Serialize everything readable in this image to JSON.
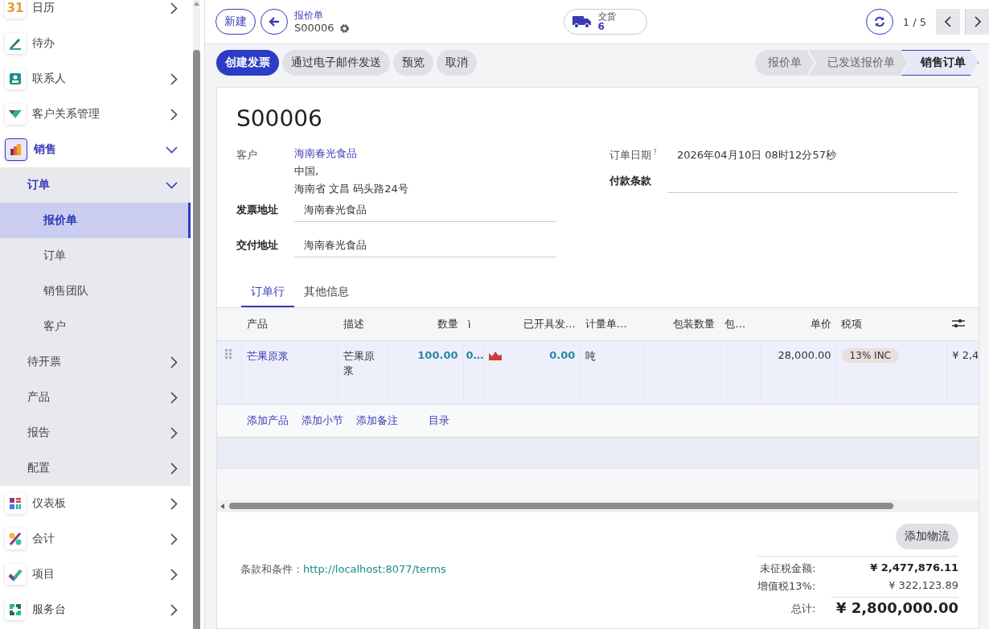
{
  "sidebar": {
    "apps": [
      {
        "label": "日历",
        "icon_text": "31",
        "has_submenu": true,
        "expanded": false,
        "selected": false
      },
      {
        "label": "待办",
        "has_submenu": false,
        "expanded": false,
        "selected": false
      },
      {
        "label": "联系人",
        "has_submenu": true,
        "expanded": false,
        "selected": false
      },
      {
        "label": "客户关系管理",
        "has_submenu": true,
        "expanded": false,
        "selected": false
      },
      {
        "label": "销售",
        "has_submenu": true,
        "expanded": true,
        "selected": true,
        "children": [
          {
            "label": "订单",
            "has_submenu": true,
            "expanded": true,
            "selected": false,
            "children": [
              {
                "label": "报价单",
                "selected": true
              },
              {
                "label": "订单",
                "selected": false
              },
              {
                "label": "销售团队",
                "selected": false
              },
              {
                "label": "客户",
                "selected": false
              }
            ]
          },
          {
            "label": "待开票",
            "has_submenu": true,
            "expanded": false,
            "selected": false
          },
          {
            "label": "产品",
            "has_submenu": true,
            "expanded": false,
            "selected": false
          },
          {
            "label": "报告",
            "has_submenu": true,
            "expanded": false,
            "selected": false
          },
          {
            "label": "配置",
            "has_submenu": true,
            "expanded": false,
            "selected": false
          }
        ]
      },
      {
        "label": "仪表板",
        "has_submenu": true,
        "expanded": false,
        "selected": false
      },
      {
        "label": "会计",
        "has_submenu": true,
        "expanded": false,
        "selected": false
      },
      {
        "label": "项目",
        "has_submenu": true,
        "expanded": false,
        "selected": false
      },
      {
        "label": "服务台",
        "has_submenu": true,
        "expanded": false,
        "selected": false
      }
    ]
  },
  "toolbar": {
    "new_button": "新建",
    "breadcrumb": "报价单",
    "record": "S00006",
    "smart_button": {
      "label": "交货",
      "count": "6"
    },
    "pager": "1 / 5"
  },
  "actions": [
    {
      "label": "创建发票",
      "primary": true
    },
    {
      "label": "通过电子邮件发送",
      "primary": false
    },
    {
      "label": "预览",
      "primary": false
    },
    {
      "label": "取消",
      "primary": false
    }
  ],
  "statusbar": [
    {
      "label": "报价单",
      "selected": false
    },
    {
      "label": "已发送报价单",
      "selected": false
    },
    {
      "label": "销售订单",
      "selected": true
    }
  ],
  "form": {
    "title": "S00006",
    "customer": {
      "label": "客户",
      "name": "海南春光食品",
      "address": [
        "中国,",
        "海南省 文昌 码头路24号"
      ]
    },
    "invoice_address": {
      "label": "发票地址",
      "value": "海南春光食品"
    },
    "delivery_address": {
      "label": "交付地址",
      "value": "海南春光食品"
    },
    "order_date": {
      "label": "订单日期",
      "help": "?",
      "value": "2026年04月10日 08时12分57秒"
    },
    "payment_terms": {
      "label": "付款条款"
    }
  },
  "tabs": [
    {
      "label": "订单行",
      "selected": true
    },
    {
      "label": "其他信息",
      "selected": false
    }
  ],
  "order_lines": {
    "columns": [
      "产品",
      "描述",
      "数量",
      "ì",
      "已开具发…",
      "计量单…",
      "包装数量",
      "包…",
      "单价",
      "税项"
    ],
    "rows": [
      {
        "product": "芒果原浆",
        "description": "芒果原浆",
        "quantity": "100.00",
        "column_4": "0…",
        "forecast_warning": true,
        "invoiced": "0.00",
        "uom": "吨",
        "price": "28,000.00",
        "taxes": [
          "13% INC"
        ],
        "column_11": "¥ 2,4"
      }
    ],
    "add_links": [
      "添加产品",
      "添加小节",
      "添加备注",
      "目录"
    ]
  },
  "footer": {
    "add_shipping": "添加物流",
    "terms_label": "条款和条件：",
    "terms_link": "http://localhost:8077/terms",
    "totals": [
      {
        "label": "未征税金额:",
        "value": "¥ 2,477,876.11",
        "kind": "untaxed"
      },
      {
        "label": "增值税13%:",
        "value": "¥ 322,123.89",
        "kind": "tax"
      },
      {
        "label": "总计:",
        "value": "¥ 2,800,000.00",
        "kind": "total"
      }
    ]
  }
}
